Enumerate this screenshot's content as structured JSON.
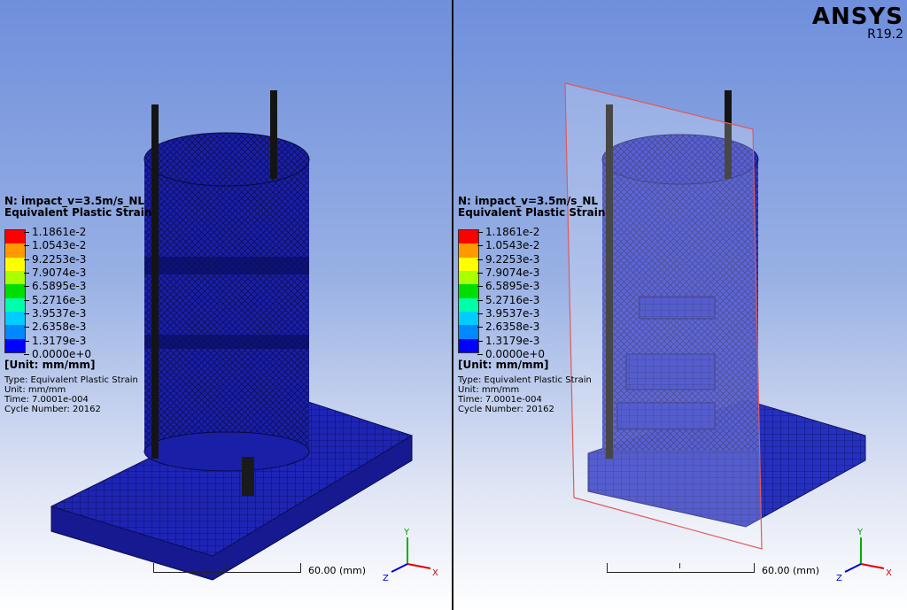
{
  "brand": {
    "name": "ANSYS",
    "version": "R19.2"
  },
  "legend": {
    "title_line1": "N: impact_v=3.5m/s_NL",
    "title_line2": "Equivalent Plastic Strain",
    "levels": [
      "1.1861e-2",
      "1.0543e-2",
      "9.2253e-3",
      "7.9074e-3",
      "6.5895e-3",
      "5.2716e-3",
      "3.9537e-3",
      "2.6358e-3",
      "1.3179e-3",
      "0.0000e+0"
    ],
    "colors": [
      "#ff0000",
      "#ff9900",
      "#ffff00",
      "#aaff00",
      "#00dd00",
      "#00ffaa",
      "#00ccff",
      "#0088ff",
      "#0000ff"
    ],
    "unit": "[Unit: mm/mm]",
    "type_line": "Type: Equivalent Plastic Strain",
    "unit_line": "Unit: mm/mm",
    "time_line": "Time: 7.0001e-004",
    "cycle_line": "Cycle Number: 20162"
  },
  "scale": {
    "label": "60.00  (mm)"
  },
  "triad": {
    "x": "X",
    "y": "Y",
    "z": "Z"
  },
  "colors": {
    "mesh_fill": "#1a1fa8",
    "mesh_dark": "#0b0e55",
    "section_plane": "#e05a5a"
  }
}
